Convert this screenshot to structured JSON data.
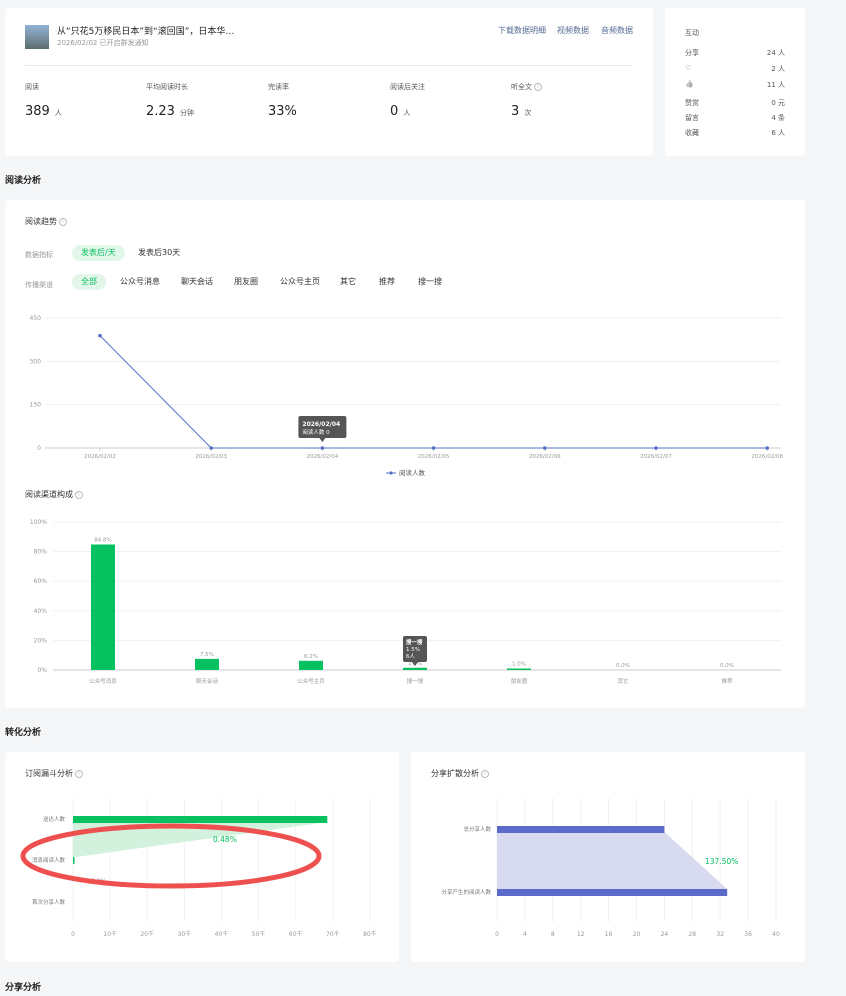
{
  "article": {
    "title": "从“只花5万移民日本”到“滚回国”，日本华…",
    "meta": "2026/02/02 已开启群发通知",
    "links": [
      "下载数据明细",
      "视频数据",
      "音频数据"
    ]
  },
  "stats": [
    {
      "label": "阅读",
      "value": "389",
      "unit": "人"
    },
    {
      "label": "平均阅读时长",
      "value": "2.23",
      "unit": "分钟"
    },
    {
      "label": "完读率",
      "value": "33%",
      "unit": ""
    },
    {
      "label": "阅读后关注",
      "value": "0",
      "unit": "人"
    },
    {
      "label": "听全文",
      "value": "3",
      "unit": "次"
    }
  ],
  "interaction": {
    "title": "互动",
    "rows": [
      {
        "label": "分享",
        "value": "24 人"
      },
      {
        "label": "♡",
        "value": "2 人"
      },
      {
        "label": "👍",
        "value": "11 人"
      },
      {
        "label": "赞赏",
        "value": "0 元"
      },
      {
        "label": "留言",
        "value": "4 条"
      },
      {
        "label": "收藏",
        "value": "6 人"
      }
    ]
  },
  "sections": {
    "reading": "阅读分析",
    "conversion": "转化分析",
    "share": "分享分析"
  },
  "trend": {
    "title": "阅读趋势",
    "metric_label": "数据指标",
    "metric_options": [
      "发表后/天",
      "发表后30天"
    ],
    "channel_label": "传播渠道",
    "channel_options": [
      "全部",
      "公众号消息",
      "聊天会话",
      "朋友圈",
      "公众号主页",
      "其它",
      "推荐",
      "搜一搜"
    ],
    "tooltip_date": "2026/02/04",
    "tooltip_value": "阅读人数 0"
  },
  "composition": {
    "title": "阅读渠道构成",
    "tooltip_name": "搜一搜",
    "tooltip_pct": "1.5%",
    "tooltip_count": "6人"
  },
  "funnel": {
    "title": "订阅漏斗分析",
    "pct_label": "0.48%",
    "zero_label": "0.0%"
  },
  "share_spread": {
    "title": "分享扩散分析",
    "pct_label": "137.50%"
  },
  "chart_data": [
    {
      "type": "line",
      "x": [
        "2026/02/02",
        "2026/02/03",
        "2026/02/04",
        "2026/02/05",
        "2026/02/06",
        "2026/02/07",
        "2026/02/08"
      ],
      "series": [
        {
          "name": "阅读人数",
          "values": [
            389,
            0,
            0,
            0,
            0,
            0,
            0
          ]
        }
      ],
      "yticks": [
        0,
        150,
        300,
        450
      ],
      "ylim": [
        0,
        450
      ],
      "color": "#5470c6"
    },
    {
      "type": "bar",
      "categories": [
        "公众号消息",
        "聊天会话",
        "公众号主页",
        "搜一搜",
        "朋友圈",
        "其它",
        "推荐"
      ],
      "values": [
        84.8,
        7.5,
        6.2,
        1.5,
        1.0,
        0.0,
        0.0
      ],
      "labels": [
        "84.8%",
        "7.5%",
        "6.2%",
        "1.5%",
        "1.0%",
        "0.0%",
        "0.0%"
      ],
      "ylim": [
        0,
        100
      ],
      "yticks": [
        "0%",
        "20%",
        "40%",
        "60%",
        "80%",
        "100%"
      ],
      "color": "#07c160"
    },
    {
      "type": "bar",
      "orientation": "horizontal",
      "categories": [
        "送达人数",
        "消息阅读人数",
        "首次分享人数"
      ],
      "values": [
        68500,
        330,
        0
      ],
      "xticks": [
        "0",
        "10千",
        "20千",
        "30千",
        "40千",
        "50千",
        "60千",
        "70千",
        "80千"
      ],
      "xlim": [
        0,
        80000
      ],
      "color": "#07c160"
    },
    {
      "type": "bar",
      "orientation": "horizontal",
      "categories": [
        "总分享人数",
        "分享产生的阅读人数"
      ],
      "values": [
        24,
        33
      ],
      "xticks": [
        "0",
        "4",
        "8",
        "12",
        "16",
        "20",
        "24",
        "28",
        "32",
        "36",
        "40"
      ],
      "xlim": [
        0,
        40
      ],
      "color": "#5b6bc9"
    }
  ]
}
